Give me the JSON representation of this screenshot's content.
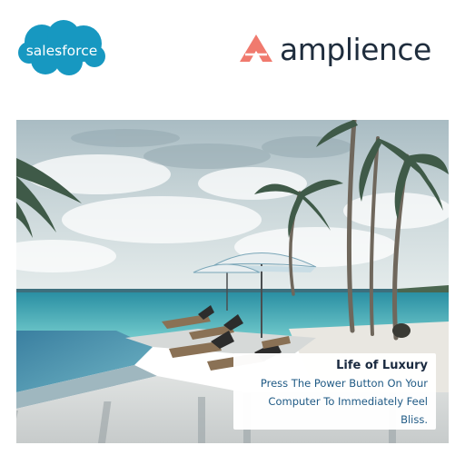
{
  "brands": {
    "salesforce": {
      "name": "salesforce",
      "color": "#1798c1"
    },
    "amplience": {
      "name": "amplience",
      "mark_color": "#f07a6e",
      "text_color": "#1f2d3d"
    }
  },
  "hero": {
    "image": "beach-resort-pool-photo",
    "caption": {
      "title": "Life of Luxury",
      "body": "Press The Power Button On Your Computer To Immediately Feel Bliss."
    }
  }
}
